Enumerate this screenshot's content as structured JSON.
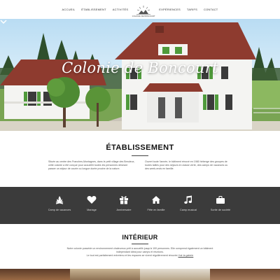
{
  "nav": {
    "left_links": [
      "ACCUEIL",
      "ÉTABLISSEMENT",
      "ACTIVITÉS"
    ],
    "right_links": [
      "EXPÉRIENCES",
      "TARIFS",
      "CONTACT"
    ],
    "logo_text": "COLONIE DE BONCOURT"
  },
  "hero": {
    "title": "Colonie de Boncourt"
  },
  "etablissement": {
    "title": "ÉTABLISSEMENT",
    "left_text": "Située au centre des Franches-Montagnes, dans le petit village des Breuleux, cette colonie a été conçue pour accueillir toutes les personnes désirant passer un séjour de courte ou longue durée proche de la nature.",
    "right_text": "Ouvert toute l'année, le bâtiment rénové en 1980 héberge des groupes de toutes tailles pour des séjours en classe verte, des camps de vacances ou des week-ends en famille."
  },
  "features": [
    {
      "label": "Camp de vacances",
      "icon": "campfire-icon"
    },
    {
      "label": "Mariage",
      "icon": "heart-icon"
    },
    {
      "label": "Anniversaire",
      "icon": "gift-icon"
    },
    {
      "label": "Fête en famille",
      "icon": "house-icon"
    },
    {
      "label": "Camp musical",
      "icon": "music-note-icon"
    },
    {
      "label": "Sortie de société",
      "icon": "briefcase-icon"
    }
  ],
  "interieur": {
    "title": "INTÉRIEUR",
    "text": "Notre colonie possède un environnement chaleureux prêt à accueillir jusqu'à 100 personnes. Elle comprend également un bâtiment indépendant idéal pour camps et réunions.",
    "text2_before": "Le tout est parfaitement entretenu et les espaces se vivent régulièrement rénovés",
    "link": "Voir la galerie"
  },
  "colors": {
    "band": "#3b3b3b",
    "roof": "#8e3b2f",
    "facade": "#f4f4f2",
    "shutters": "#4f9a3b"
  }
}
